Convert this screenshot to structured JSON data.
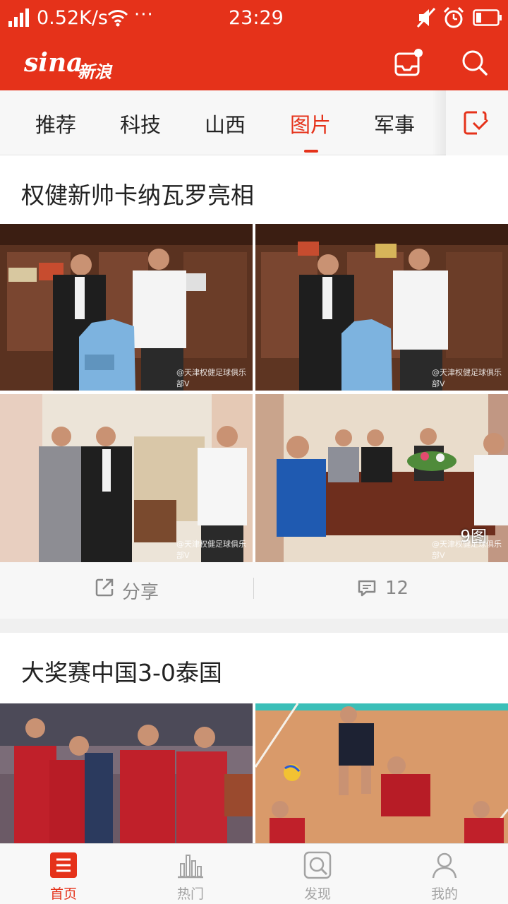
{
  "status_bar": {
    "network_speed": "0.52K/s",
    "more": "···",
    "time": "23:29"
  },
  "header": {
    "logo_latin": "sina",
    "logo_cn": "新浪"
  },
  "tabs": [
    {
      "label": "推荐",
      "active": false
    },
    {
      "label": "科技",
      "active": false
    },
    {
      "label": "山西",
      "active": false
    },
    {
      "label": "图片",
      "active": true
    },
    {
      "label": "军事",
      "active": false
    }
  ],
  "feed": [
    {
      "title": "权健新帅卡纳瓦罗亮相",
      "photo_count_label": "9图",
      "watermark": "@天津权健足球俱乐部V",
      "share_label": "分享",
      "comment_count": "12"
    },
    {
      "title": "大奖赛中国3-0泰国"
    }
  ],
  "bottom_nav": [
    {
      "label": "首页",
      "icon": "home-icon",
      "active": true
    },
    {
      "label": "热门",
      "icon": "trending-icon",
      "active": false
    },
    {
      "label": "发现",
      "icon": "discover-icon",
      "active": false
    },
    {
      "label": "我的",
      "icon": "profile-icon",
      "active": false
    }
  ],
  "colors": {
    "brand_red": "#e5321a",
    "inactive_gray": "#a3a3a3"
  }
}
